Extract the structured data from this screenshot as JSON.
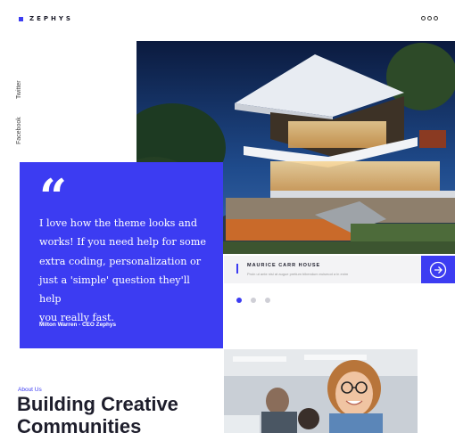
{
  "brand": {
    "name": "ZEPHYS",
    "accent": "#3c3cf2"
  },
  "menu": {
    "icon": "more-dots-icon"
  },
  "social": {
    "twitter": "Twitter",
    "facebook": "Facebook"
  },
  "hero": {
    "image": "modern-house-night-photo"
  },
  "project": {
    "title": "MAURICE CARR HOUSE",
    "subtitle": "Proin ut ante nisi at augue pretium bibendum euismod a in enim",
    "next_icon": "arrow-right-circle-icon"
  },
  "slider": {
    "count": 3,
    "active": 1
  },
  "testimonial": {
    "quote_icon": "quote-icon",
    "quote_mark": "“",
    "lines": [
      "I love how the theme looks and",
      "works! If you need help for some",
      "extra coding, personalization or",
      "just a 'simple' question they'll help",
      "you really fast."
    ],
    "author": "Milton Warren - CEO Zephys"
  },
  "about": {
    "label": "About Us",
    "heading_lines": [
      "Building Creative",
      "Communities"
    ]
  },
  "team": {
    "image": "smiling-woman-glasses-photo"
  }
}
